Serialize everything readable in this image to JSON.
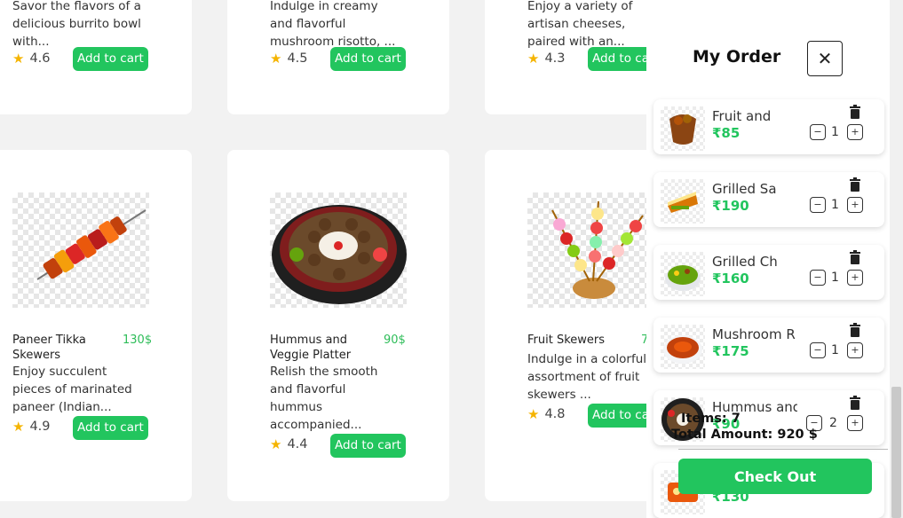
{
  "menu": {
    "top_row": [
      {
        "desc_lines": [
          "Savor the flavors of a",
          "delicious burrito bowl",
          "with..."
        ],
        "rating": "4.6",
        "add_label": "Add to cart"
      },
      {
        "desc_lines": [
          "Indulge in creamy",
          "and flavorful",
          "mushroom risotto, ..."
        ],
        "rating": "4.5",
        "add_label": "Add to cart"
      },
      {
        "desc_lines": [
          "Enjoy a variety of",
          "artisan cheeses,",
          "paired with an..."
        ],
        "rating": "4.3",
        "add_label": "Add to cart"
      }
    ],
    "bottom_row": [
      {
        "name": "Paneer Tikka Skewers",
        "price": "130$",
        "desc": "Enjoy succulent pieces of marinated paneer (Indian...",
        "rating": "4.9",
        "add_label": "Add to cart"
      },
      {
        "name": "Hummus and Veggie Platter",
        "price": "90$",
        "desc": "Relish the smooth and flavorful hummus accompanied...",
        "rating": "4.4",
        "add_label": "Add to cart"
      },
      {
        "name": "Fruit Skewers",
        "price": "7",
        "desc": "Indulge in a colorful assortment of fruit skewers ...",
        "rating": "4.8",
        "add_label": "Add to cart"
      }
    ]
  },
  "order": {
    "title": "My Order",
    "close_icon": "close-icon",
    "items": [
      {
        "name": "Fruit and",
        "price": "₹85",
        "qty": "1"
      },
      {
        "name": "Grilled Sa",
        "price": "₹190",
        "qty": "1"
      },
      {
        "name": "Grilled Ch",
        "price": "₹160",
        "qty": "1"
      },
      {
        "name": "Mushroom R",
        "price": "₹175",
        "qty": "1"
      },
      {
        "name": "Hummus and",
        "price": "₹90",
        "qty": "2"
      },
      {
        "name": "",
        "price": "₹130",
        "qty": ""
      }
    ],
    "total_items": "Items: 7",
    "total_amount": "Total Amount: 920 $",
    "checkout_label": "Check Out"
  },
  "colors": {
    "accent": "#22c55e",
    "star": "#f5b400",
    "price": "#2ebd59"
  }
}
